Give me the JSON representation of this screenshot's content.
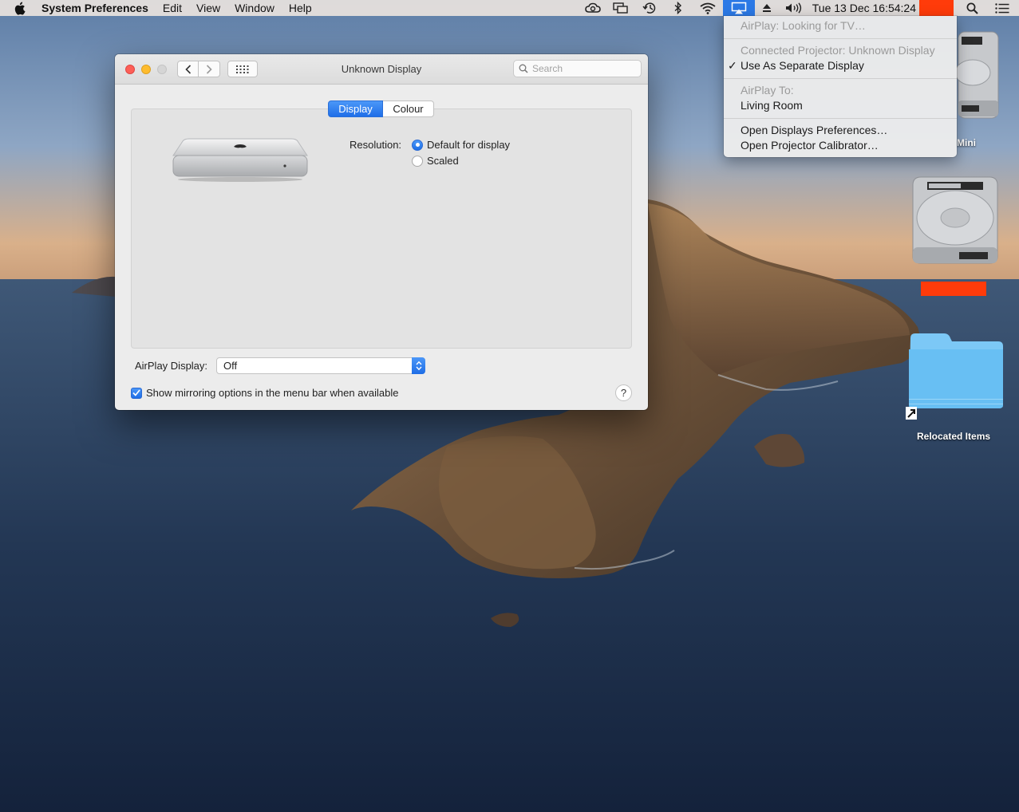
{
  "menubar": {
    "apple_icon": "apple-logo-icon",
    "app_name": "System Preferences",
    "menus": [
      "Edit",
      "View",
      "Window",
      "Help"
    ],
    "status_icons": [
      "creative-cloud-icon",
      "display-mirroring-icon",
      "time-machine-icon",
      "bluetooth-icon",
      "wifi-icon",
      "airplay-icon",
      "eject-icon",
      "volume-icon"
    ],
    "clock": "Tue 13 Dec  16:54:24",
    "spotlight_icon": "spotlight-search-icon",
    "notification_icon": "notification-center-icon",
    "accent": "#2b79e6"
  },
  "airplay_menu": {
    "looking": "AirPlay: Looking for TV…",
    "connected": "Connected Projector: Unknown Display",
    "separate": "Use As Separate Display",
    "separate_checked": true,
    "airplay_to_heading": "AirPlay To:",
    "device": "Living Room",
    "open_prefs": "Open Displays Preferences…",
    "open_calibrator": "Open Projector Calibrator…"
  },
  "window": {
    "title": "Unknown Display",
    "search_placeholder": "Search",
    "tabs": [
      {
        "label": "Display",
        "active": true
      },
      {
        "label": "Colour",
        "active": false
      }
    ],
    "resolution_label": "Resolution:",
    "resolution_options": [
      {
        "label": "Default for display",
        "selected": true
      },
      {
        "label": "Scaled",
        "selected": false
      }
    ],
    "airplay_display_label": "AirPlay Display:",
    "airplay_display_value": "Off",
    "mirroring_checkbox_label": "Show mirroring options in the menu bar when available",
    "mirroring_checked": true,
    "help_label": "?"
  },
  "desktop": {
    "items": [
      {
        "label": "Mini",
        "icon": "hard-drive-icon"
      },
      {
        "label": "",
        "icon": "hard-drive-icon"
      },
      {
        "label": "Relocated Items",
        "icon": "folder-alias-icon"
      }
    ]
  },
  "colors": {
    "redaction": "#ff3b0a",
    "close": "#fd5f57",
    "minimize": "#febc2e",
    "accent_blue": "#1f6fe8",
    "folder": "#6cc3f5"
  }
}
